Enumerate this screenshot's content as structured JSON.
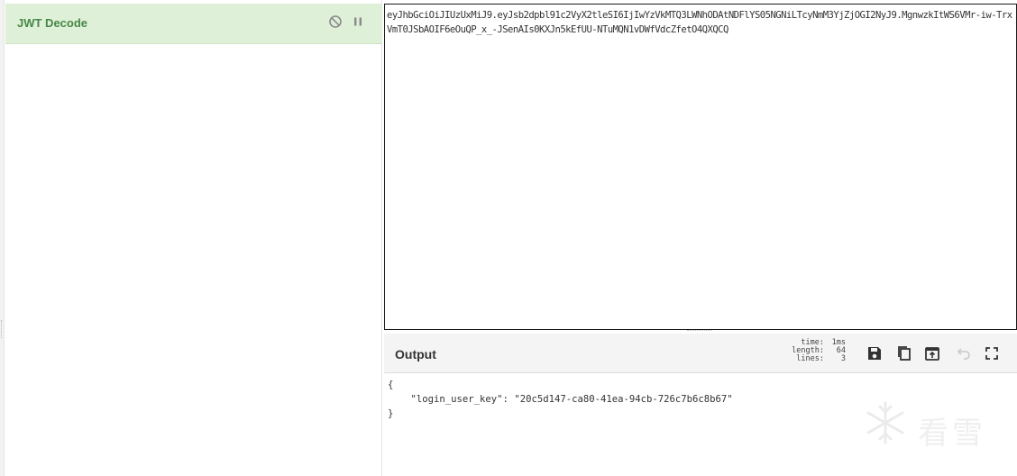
{
  "recipe": {
    "operation_title": "JWT Decode",
    "icons": {
      "disable": "disable-icon",
      "pause": "pause-icon"
    }
  },
  "input": {
    "text": "eyJhbGciOiJIUzUxMiJ9.eyJsb2dpbl91c2VyX2tleSI6IjIwYzVkMTQ3LWNhODAtNDFlYS05NGNiLTcyNmM3YjZjOGI2NyJ9.MgnwzkItWS6VMr-iw-TrxVmT0JSbAOIF6eOuQP_x_-JSenAIs0KXJn5kEfUU-NTuMQN1vDWfVdcZfetO4QXQCQ"
  },
  "output": {
    "title": "Output",
    "stats": {
      "time_label": "time:",
      "time_value": "1ms",
      "length_label": "length:",
      "length_value": "64",
      "lines_label": "lines:",
      "lines_value": "3"
    },
    "buttons": [
      "save-icon",
      "copy-icon",
      "replace-input-icon",
      "undo-icon",
      "maximize-icon"
    ],
    "text": "{\n    \"login_user_key\": \"20c5d147-ca80-41ea-94cb-726c7b6c8b67\"\n}",
    "watermark_text": "看雪"
  }
}
